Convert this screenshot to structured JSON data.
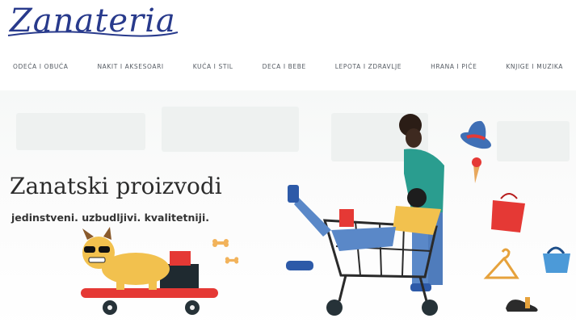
{
  "brand": {
    "logo_text": "Zanateria"
  },
  "nav": {
    "items": [
      "ODEĆA I OBUĆA",
      "NAKIT I AKSESOARI",
      "KUĆA I STIL",
      "DECA I BEBE",
      "LEPOTA I ZDRAVLJE",
      "HRANA I PIĆE",
      "KNJIGE I MUZIKA"
    ]
  },
  "hero": {
    "title": "Zanatski proizvodi",
    "subtitle": "jedinstveni. uzbudljivi. kvalitetniji."
  },
  "colors": {
    "brand": "#283a8c",
    "nav_text": "#555b63",
    "heading": "#2c2c2c",
    "accent_red": "#e53935",
    "accent_teal": "#2a9d8f",
    "accent_yellow": "#f2c14e"
  },
  "icons": [
    "logo-swoosh",
    "dog-on-skateboard",
    "shopping-cart",
    "hat",
    "shopping-bag",
    "hanger",
    "handbag",
    "shoe",
    "bone"
  ]
}
